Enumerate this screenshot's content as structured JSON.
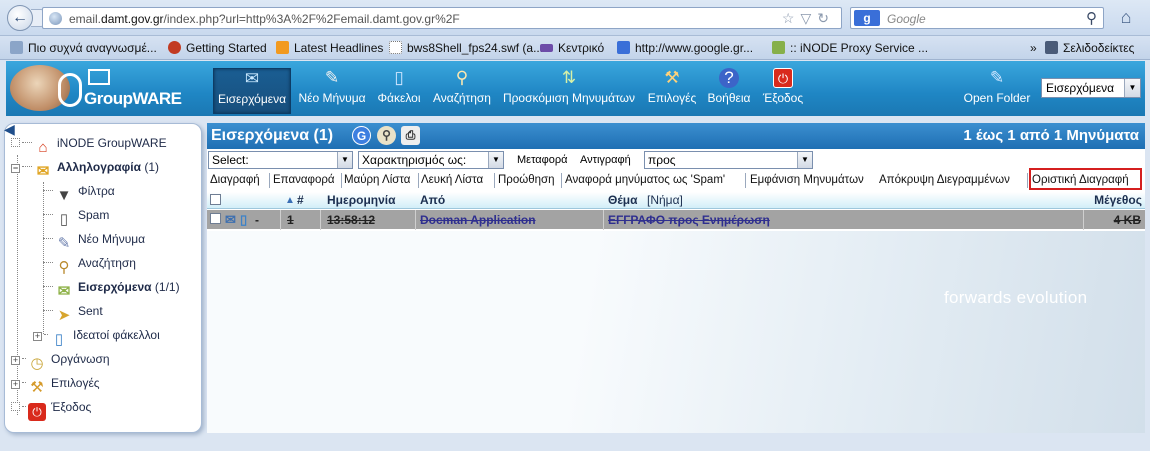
{
  "browser": {
    "url_prefix": "email.",
    "url_domain": "damt.gov.gr",
    "url_rest": "/index.php?url=http%3A%2F%2Femail.damt.gov.gr%2F",
    "search_engine": "g",
    "search_placeholder": "Google"
  },
  "bookmarks": [
    {
      "label": "Πιο συχνά αναγνωσμέ...",
      "icon": "page-icon"
    },
    {
      "label": "Getting Started",
      "icon": "firefox-icon"
    },
    {
      "label": "Latest Headlines",
      "icon": "rss-icon"
    },
    {
      "label": "bws8Shell_fps24.swf (a...",
      "icon": "blank-page-icon"
    },
    {
      "label": "Κεντρικό",
      "icon": "lizard-icon"
    },
    {
      "label": "http://www.google.gr...",
      "icon": "google-icon"
    },
    {
      "label": ":: iNODE Proxy Service ...",
      "icon": "proxy-icon"
    },
    {
      "label": "Σελιδοδείκτες",
      "icon": "bookmarks-icon"
    }
  ],
  "app": {
    "logo_text": "GroupWARE",
    "toolbar": [
      {
        "label": "Εισερχόμενα",
        "icon": "inbox-icon",
        "active": true
      },
      {
        "label": "Νέο Μήνυμα",
        "icon": "compose-icon"
      },
      {
        "label": "Φάκελοι",
        "icon": "folders-icon"
      },
      {
        "label": "Αναζήτηση",
        "icon": "search-icon"
      },
      {
        "label": "Προσκόμιση Μηνυμάτων",
        "icon": "fetch-icon"
      },
      {
        "label": "Επιλογές",
        "icon": "options-icon"
      },
      {
        "label": "Βοήθεια",
        "icon": "help-icon"
      },
      {
        "label": "Έξοδος",
        "icon": "exit-icon"
      },
      {
        "label": "Open Folder",
        "icon": "open-folder-icon"
      }
    ],
    "folder_select": "Εισερχόμενα"
  },
  "sidebar": {
    "items": [
      {
        "label": "iNODE GroupWARE",
        "icon": "home-icon",
        "bold": false
      },
      {
        "label": "Αλληλογραφία",
        "count": "(1)",
        "icon": "mail-icon",
        "bold": true
      },
      {
        "label": "Φίλτρα",
        "icon": "filter-icon",
        "bold": false
      },
      {
        "label": "Spam",
        "icon": "spam-bin-icon",
        "bold": false
      },
      {
        "label": "Νέο Μήνυμα",
        "icon": "compose-icon",
        "bold": false
      },
      {
        "label": "Αναζήτηση",
        "icon": "search-icon",
        "bold": false
      },
      {
        "label": "Εισερχόμενα",
        "count": "(1/1)",
        "icon": "inbox-icon",
        "bold": true
      },
      {
        "label": "Sent",
        "icon": "sent-icon",
        "bold": false
      },
      {
        "label": "Ιδεατοί φάκελλοι",
        "icon": "virtual-folders-icon",
        "bold": false
      },
      {
        "label": "Οργάνωση",
        "icon": "organizer-icon",
        "bold": false
      },
      {
        "label": "Επιλογές",
        "icon": "options-icon",
        "bold": false
      },
      {
        "label": "Έξοδος",
        "icon": "exit-icon",
        "bold": false
      }
    ]
  },
  "main": {
    "folder_title": "Εισερχόμενα (1)",
    "message_range": "1 έως 1 από 1 Μηνύματα",
    "select_value": "Select:",
    "mark_as_value": "Χαρακτηρισμός ως:",
    "move_label": "Μεταφορά",
    "copy_label": "Αντιγραφή",
    "to_value": "προς",
    "actions": [
      "Διαγραφή",
      "Επαναφορά",
      "Μαύρη Λίστα",
      "Λευκή Λίστα",
      "Προώθηση",
      "Αναφορά μηνύματος ως 'Spam'",
      "Εμφάνιση Μηνυμάτων",
      "Απόκρυψη Διεγραμμένων",
      "Οριστική Διαγραφή"
    ],
    "columns": {
      "num": "#",
      "date": "Ημερομηνία",
      "from": "Από",
      "subject": "Θέμα",
      "thread": "[Νήμα]",
      "size": "Μέγεθος"
    },
    "rows": [
      {
        "num": "1",
        "date": "13:58:12",
        "from": "Docman Application",
        "subject": "ΕΓΓΡΑΦΟ προς Ενημέρωση",
        "size": "4 KB",
        "deleted": true
      }
    ],
    "watermark": "forwards evolution"
  }
}
